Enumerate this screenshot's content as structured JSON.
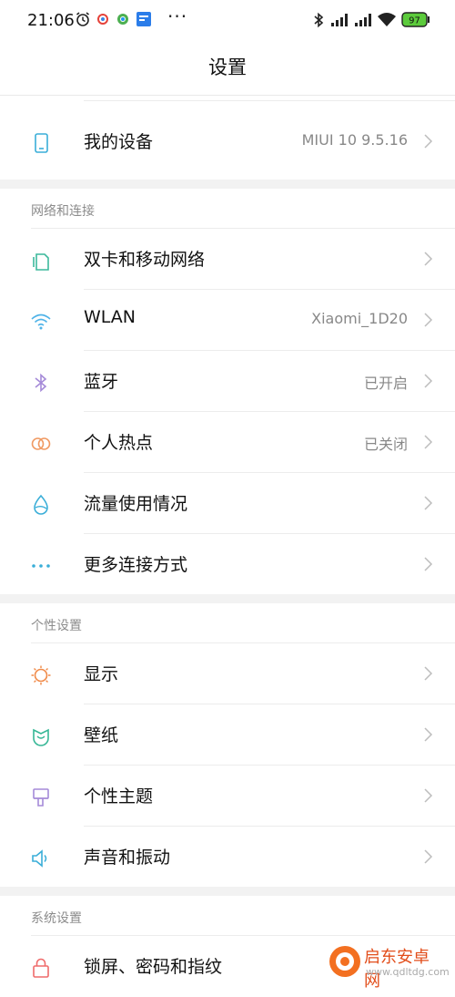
{
  "status_bar": {
    "time": "21:06",
    "battery": "97"
  },
  "title": "设置",
  "device_row": {
    "label": "我的设备",
    "value": "MIUI 10 9.5.16"
  },
  "sections": [
    {
      "header": "网络和连接",
      "items": [
        {
          "label": "双卡和移动网络",
          "value": ""
        },
        {
          "label": "WLAN",
          "value": "Xiaomi_1D20"
        },
        {
          "label": "蓝牙",
          "value": "已开启"
        },
        {
          "label": "个人热点",
          "value": "已关闭"
        },
        {
          "label": "流量使用情况",
          "value": ""
        },
        {
          "label": "更多连接方式",
          "value": ""
        }
      ]
    },
    {
      "header": "个性设置",
      "items": [
        {
          "label": "显示",
          "value": ""
        },
        {
          "label": "壁纸",
          "value": ""
        },
        {
          "label": "个性主题",
          "value": ""
        },
        {
          "label": "声音和振动",
          "value": ""
        }
      ]
    },
    {
      "header": "系统设置",
      "items": [
        {
          "label": "锁屏、密码和指纹",
          "value": ""
        }
      ]
    }
  ],
  "watermark": {
    "name": "启东安卓网",
    "url": "www.qdltdg.com"
  },
  "colors": {
    "sim": "#3cb99c",
    "wifi": "#4fb3e8",
    "bluetooth": "#a58ad8",
    "hotspot": "#f09a63",
    "data": "#3aaed8",
    "more": "#3aaed8",
    "display": "#f08a48",
    "wallpaper": "#36b796",
    "theme": "#a58ad8",
    "sound": "#3aaed8",
    "lock": "#ef6b6b",
    "device": "#3aaed8"
  }
}
